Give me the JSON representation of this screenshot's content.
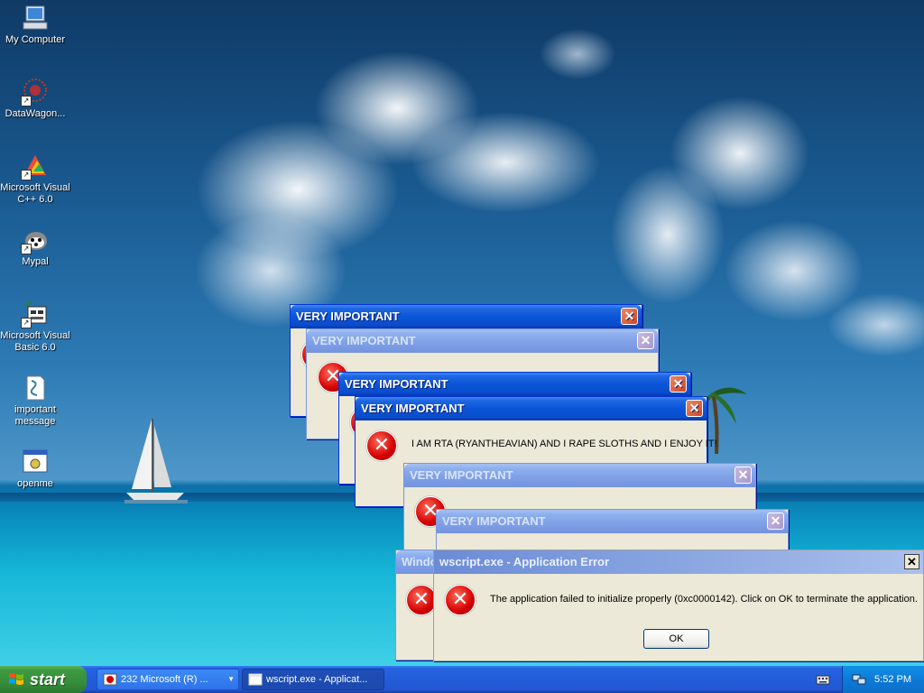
{
  "desktop": {
    "icons": [
      {
        "label": "My Computer",
        "icon": "my-computer-icon"
      },
      {
        "label": "DataWagon...",
        "icon": "datawagon-icon"
      },
      {
        "label": "Microsoft Visual C++ 6.0",
        "icon": "visual-cpp-icon"
      },
      {
        "label": "Mypal",
        "icon": "mypal-icon"
      },
      {
        "label": "Microsoft Visual Basic 6.0",
        "icon": "visual-basic-icon"
      },
      {
        "label": "important message",
        "icon": "script-file-icon"
      },
      {
        "label": "openme",
        "icon": "program-icon"
      }
    ]
  },
  "dialogs": {
    "title": "VERY IMPORTANT",
    "message": "I AM RTA (RYANTHEAVIAN) AND I RAPE SLOTHS AND I ENJOY IT!",
    "partial_title": "Windo",
    "close_glyph": "✕",
    "error_glyph": "✕"
  },
  "app_error": {
    "title": "wscript.exe - Application Error",
    "message": "The application failed to initialize properly (0xc0000142). Click on OK to terminate the application.",
    "ok_label": "OK",
    "close_glyph": "✕"
  },
  "taskbar": {
    "start_label": "start",
    "tasks": [
      {
        "label": "232 Microsoft (R) ..."
      },
      {
        "label": "wscript.exe - Applicat..."
      }
    ],
    "clock": "5:52 PM"
  },
  "colors": {
    "titlebar_active": "#0a55d8",
    "dialog_face": "#ece9d8",
    "start_green": "#3c9b40",
    "taskbar_blue": "#245edb"
  }
}
